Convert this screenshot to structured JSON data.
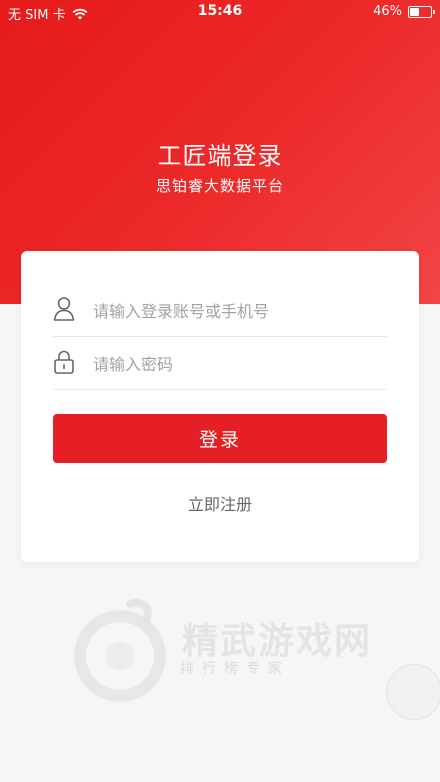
{
  "status_bar": {
    "carrier": "无 SIM 卡",
    "time": "15:46",
    "battery_text": "46%",
    "battery_level": 0.46,
    "icons": [
      "wifi-icon",
      "battery-icon"
    ]
  },
  "header": {
    "title": "工匠端登录",
    "subtitle": "思铂睿大数据平台"
  },
  "form": {
    "username_placeholder": "请输入登录账号或手机号",
    "password_placeholder": "请输入密码",
    "login_label": "登录",
    "register_label": "立即注册"
  },
  "watermark": {
    "brand": "精武游戏网",
    "slogan": "排行榜专家"
  },
  "colors": {
    "accent": "#e51f24",
    "hero_start": "#e61a1a",
    "hero_end": "#f24545"
  }
}
